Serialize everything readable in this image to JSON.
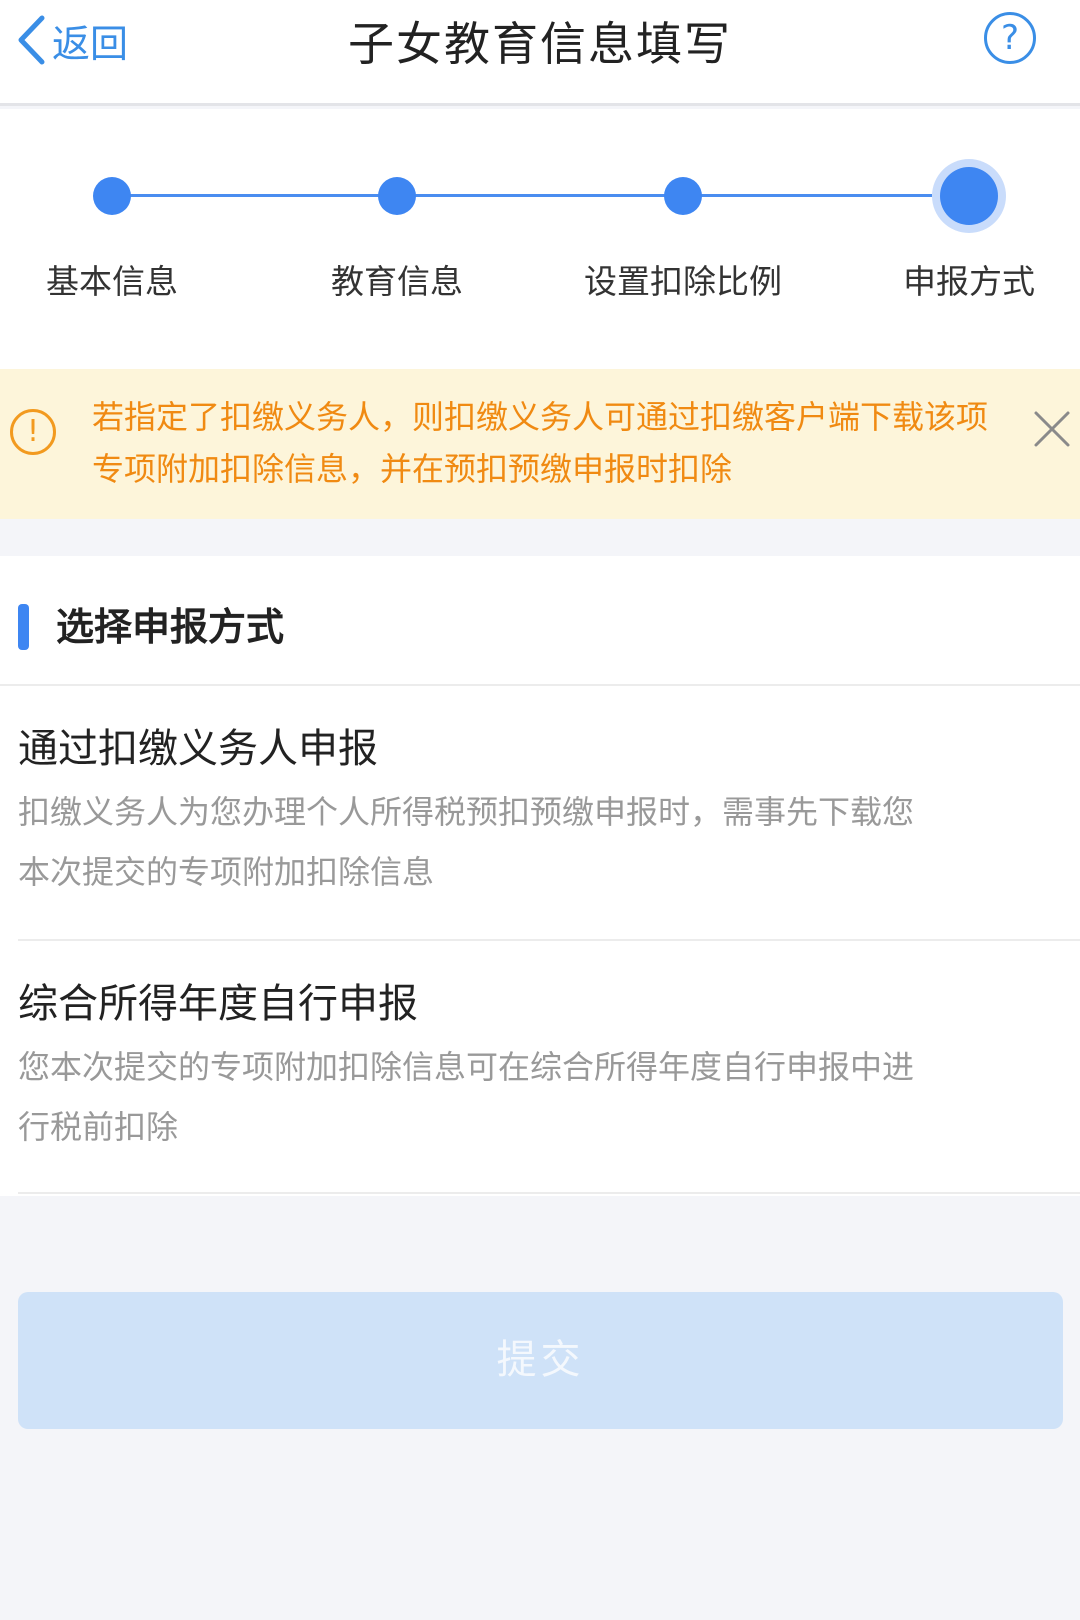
{
  "header": {
    "back_label": "返回",
    "title": "子女教育信息填写",
    "help_symbol": "?"
  },
  "stepper": {
    "steps": [
      {
        "label": "基本信息"
      },
      {
        "label": "教育信息"
      },
      {
        "label": "设置扣除比例"
      },
      {
        "label": "申报方式"
      }
    ],
    "current_step": 4
  },
  "notice": {
    "icon_symbol": "!",
    "text": "若指定了扣缴义务人，则扣缴义务人可通过扣缴客户端下载该项专项附加扣除信息，并在预扣预缴申报时扣除"
  },
  "section": {
    "title": "选择申报方式",
    "options": [
      {
        "title": "通过扣缴义务人申报",
        "desc": "扣缴义务人为您办理个人所得税预扣预缴申报时，需事先下载您本次提交的专项附加扣除信息"
      },
      {
        "title": "综合所得年度自行申报",
        "desc": "您本次提交的专项附加扣除信息可在综合所得年度自行申报中进行税前扣除"
      }
    ]
  },
  "submit_label": "提交",
  "colors": {
    "accent": "#3e86f2",
    "notice_bg": "#fdf5da",
    "notice_text": "#f08a12",
    "submit_disabled_bg": "#cfe2f8"
  }
}
